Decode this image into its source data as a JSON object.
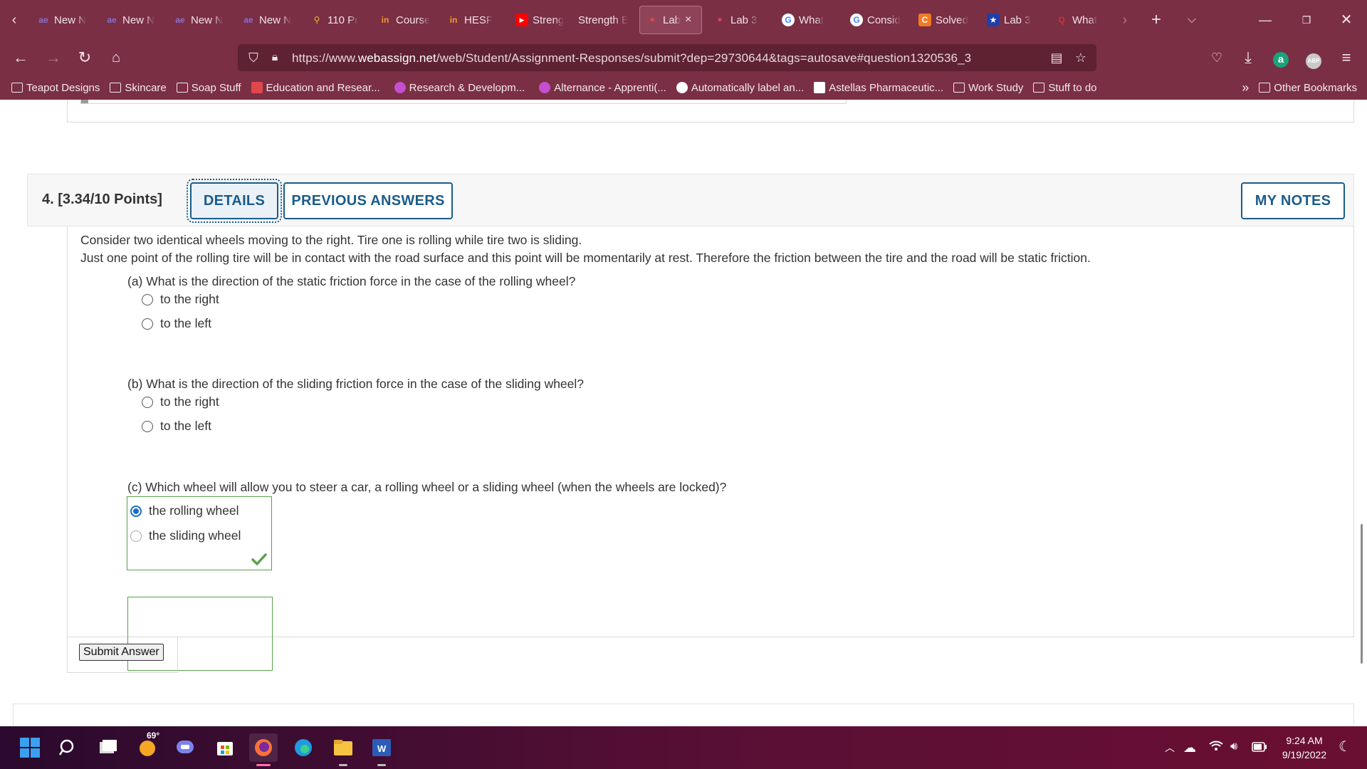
{
  "browser": {
    "tabs": [
      {
        "label": "New N",
        "icon": "ae"
      },
      {
        "label": "New N",
        "icon": "ae"
      },
      {
        "label": "New N",
        "icon": "ae"
      },
      {
        "label": "New N",
        "icon": "ae"
      },
      {
        "label": "110 Pr",
        "icon": "maps"
      },
      {
        "label": "Course",
        "icon": "in"
      },
      {
        "label": "HESF",
        "icon": "in"
      },
      {
        "label": "Streng",
        "icon": "youtube"
      },
      {
        "label": "Strength E",
        "icon": ""
      },
      {
        "label": "Lab",
        "icon": "webassign",
        "active": true
      },
      {
        "label": "Lab 3",
        "icon": "webassign"
      },
      {
        "label": "What",
        "icon": "google"
      },
      {
        "label": "Consid",
        "icon": "google"
      },
      {
        "label": "Solved",
        "icon": "chegg"
      },
      {
        "label": "Lab 3",
        "icon": "star"
      },
      {
        "label": "What",
        "icon": "quora"
      }
    ],
    "active_tab_close": "×",
    "url_prefix": "https://www.",
    "url_domain": "webassign.net",
    "url_path": "/web/Student/Assignment-Responses/submit?dep=29730644&tags=autosave#question1320536_3",
    "bookmarks": [
      {
        "label": "Teapot Designs",
        "type": "folder"
      },
      {
        "label": "Skincare",
        "type": "folder"
      },
      {
        "label": "Soap Stuff",
        "type": "folder"
      },
      {
        "label": "Education and Resear...",
        "type": "site",
        "color": "#e0474c"
      },
      {
        "label": "Research & Developm...",
        "type": "site",
        "color": "#c44fcf"
      },
      {
        "label": "Alternance - Apprenti(...",
        "type": "site",
        "color": "#c44fcf"
      },
      {
        "label": "Automatically label an...",
        "type": "site",
        "color": "#ffffff"
      },
      {
        "label": "Astellas Pharmaceutic...",
        "type": "site",
        "color": "#ffffff"
      },
      {
        "label": "Work Study",
        "type": "folder"
      },
      {
        "label": "Stuff to do",
        "type": "folder"
      }
    ],
    "bookmarks_more": "»",
    "other_bookmarks": "Other Bookmarks",
    "profile_badge": "ABP",
    "amazon_badge": "a"
  },
  "question": {
    "number_label": "4.  [3.34/10 Points]",
    "details_label": "DETAILS",
    "previous_answers_label": "PREVIOUS ANSWERS",
    "my_notes_label": "MY NOTES",
    "intro_line1": "Consider two identical wheels moving to the right. Tire one is rolling while tire two is sliding.",
    "intro_line2": "Just one point of the rolling tire will be in contact with the road surface and this point will be momentarily at rest. Therefore the friction between the tire and the road will be static friction.",
    "part_a": {
      "prompt": "(a) What is the direction of the static friction force in the case of the rolling wheel?",
      "options": [
        "to the right",
        "to the left"
      ]
    },
    "part_b": {
      "prompt": "(b) What is the direction of the sliding friction force in the case of the sliding wheel?",
      "options": [
        "to the right",
        "to the left"
      ]
    },
    "part_c": {
      "prompt": "(c) Which wheel will allow you to steer a car, a rolling wheel or a sliding wheel (when the wheels are locked)?",
      "options": [
        "the rolling wheel",
        "the sliding wheel"
      ],
      "selected": "the rolling wheel",
      "status": "correct"
    },
    "submit_label": "Submit Answer"
  },
  "taskbar": {
    "weather_temp": "69°",
    "time": "9:24 AM",
    "date": "9/19/2022"
  },
  "colors": {
    "chrome_bg": "#7a2f45",
    "accent_blue": "#1a5c8b",
    "correct_green": "#5aa04a"
  }
}
